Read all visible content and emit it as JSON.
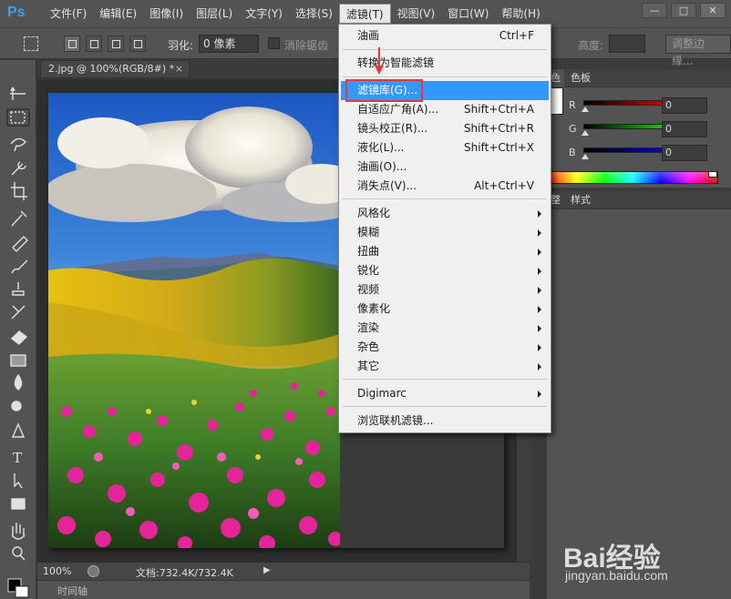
{
  "app": {
    "logo": "Ps"
  },
  "menubar": {
    "items": [
      "文件(F)",
      "编辑(E)",
      "图像(I)",
      "图层(L)",
      "文字(Y)",
      "选择(S)",
      "滤镜(T)",
      "视图(V)",
      "窗口(W)",
      "帮助(H)"
    ],
    "active_index": 6
  },
  "window_buttons": {
    "minimize": "—",
    "restore": "□",
    "close": "✕"
  },
  "options_bar": {
    "feather_label": "羽化:",
    "feather_value": "0 像素",
    "antialias_label": "消除锯齿",
    "height_label": "高度:",
    "refine_edge_button": "调整边缘..."
  },
  "document": {
    "tab_title": "2.jpg @ 100%(RGB/8#) *",
    "tab_close": "×",
    "zoom": "100%",
    "doc_info": "文档:732.4K/732.4K",
    "timeline_label": "时间轴"
  },
  "color_panel": {
    "tabs": [
      "色",
      "色板"
    ],
    "channels": [
      {
        "letter": "R",
        "value": "0",
        "color": "#ff0000"
      },
      {
        "letter": "G",
        "value": "0",
        "color": "#00ff00"
      },
      {
        "letter": "B",
        "value": "0",
        "color": "#0000ff"
      }
    ]
  },
  "styles_panel": {
    "tabs": [
      "整",
      "样式"
    ]
  },
  "filter_menu": {
    "items": [
      {
        "label": "油画",
        "shortcut": "Ctrl+F"
      },
      {
        "label": "转换为智能滤镜",
        "shortcut": ""
      },
      {
        "label": "滤镜库(G)...",
        "shortcut": "",
        "highlighted": true
      },
      {
        "label": "自适应广角(A)...",
        "shortcut": "Shift+Ctrl+A"
      },
      {
        "label": "镜头校正(R)...",
        "shortcut": "Shift+Ctrl+R"
      },
      {
        "label": "液化(L)...",
        "shortcut": "Shift+Ctrl+X"
      },
      {
        "label": "油画(O)...",
        "shortcut": ""
      },
      {
        "label": "消失点(V)...",
        "shortcut": "Alt+Ctrl+V"
      },
      {
        "label": "风格化",
        "submenu": true
      },
      {
        "label": "模糊",
        "submenu": true
      },
      {
        "label": "扭曲",
        "submenu": true
      },
      {
        "label": "锐化",
        "submenu": true
      },
      {
        "label": "视频",
        "submenu": true
      },
      {
        "label": "像素化",
        "submenu": true
      },
      {
        "label": "渲染",
        "submenu": true
      },
      {
        "label": "杂色",
        "submenu": true
      },
      {
        "label": "其它",
        "submenu": true
      },
      {
        "label": "Digimarc",
        "submenu": true
      },
      {
        "label": "浏览联机滤镜..."
      }
    ]
  },
  "watermark": {
    "brand": "Bai经验",
    "url": "jingyan.baidu.com"
  },
  "tools": [
    "move-tool",
    "marquee-tool",
    "lasso-tool",
    "quick-select-tool",
    "crop-tool",
    "eyedropper-tool",
    "healing-brush-tool",
    "brush-tool",
    "clone-stamp-tool",
    "history-brush-tool",
    "eraser-tool",
    "gradient-tool",
    "blur-tool",
    "dodge-tool",
    "pen-tool",
    "type-tool",
    "path-select-tool",
    "rectangle-tool",
    "hand-tool",
    "zoom-tool"
  ]
}
